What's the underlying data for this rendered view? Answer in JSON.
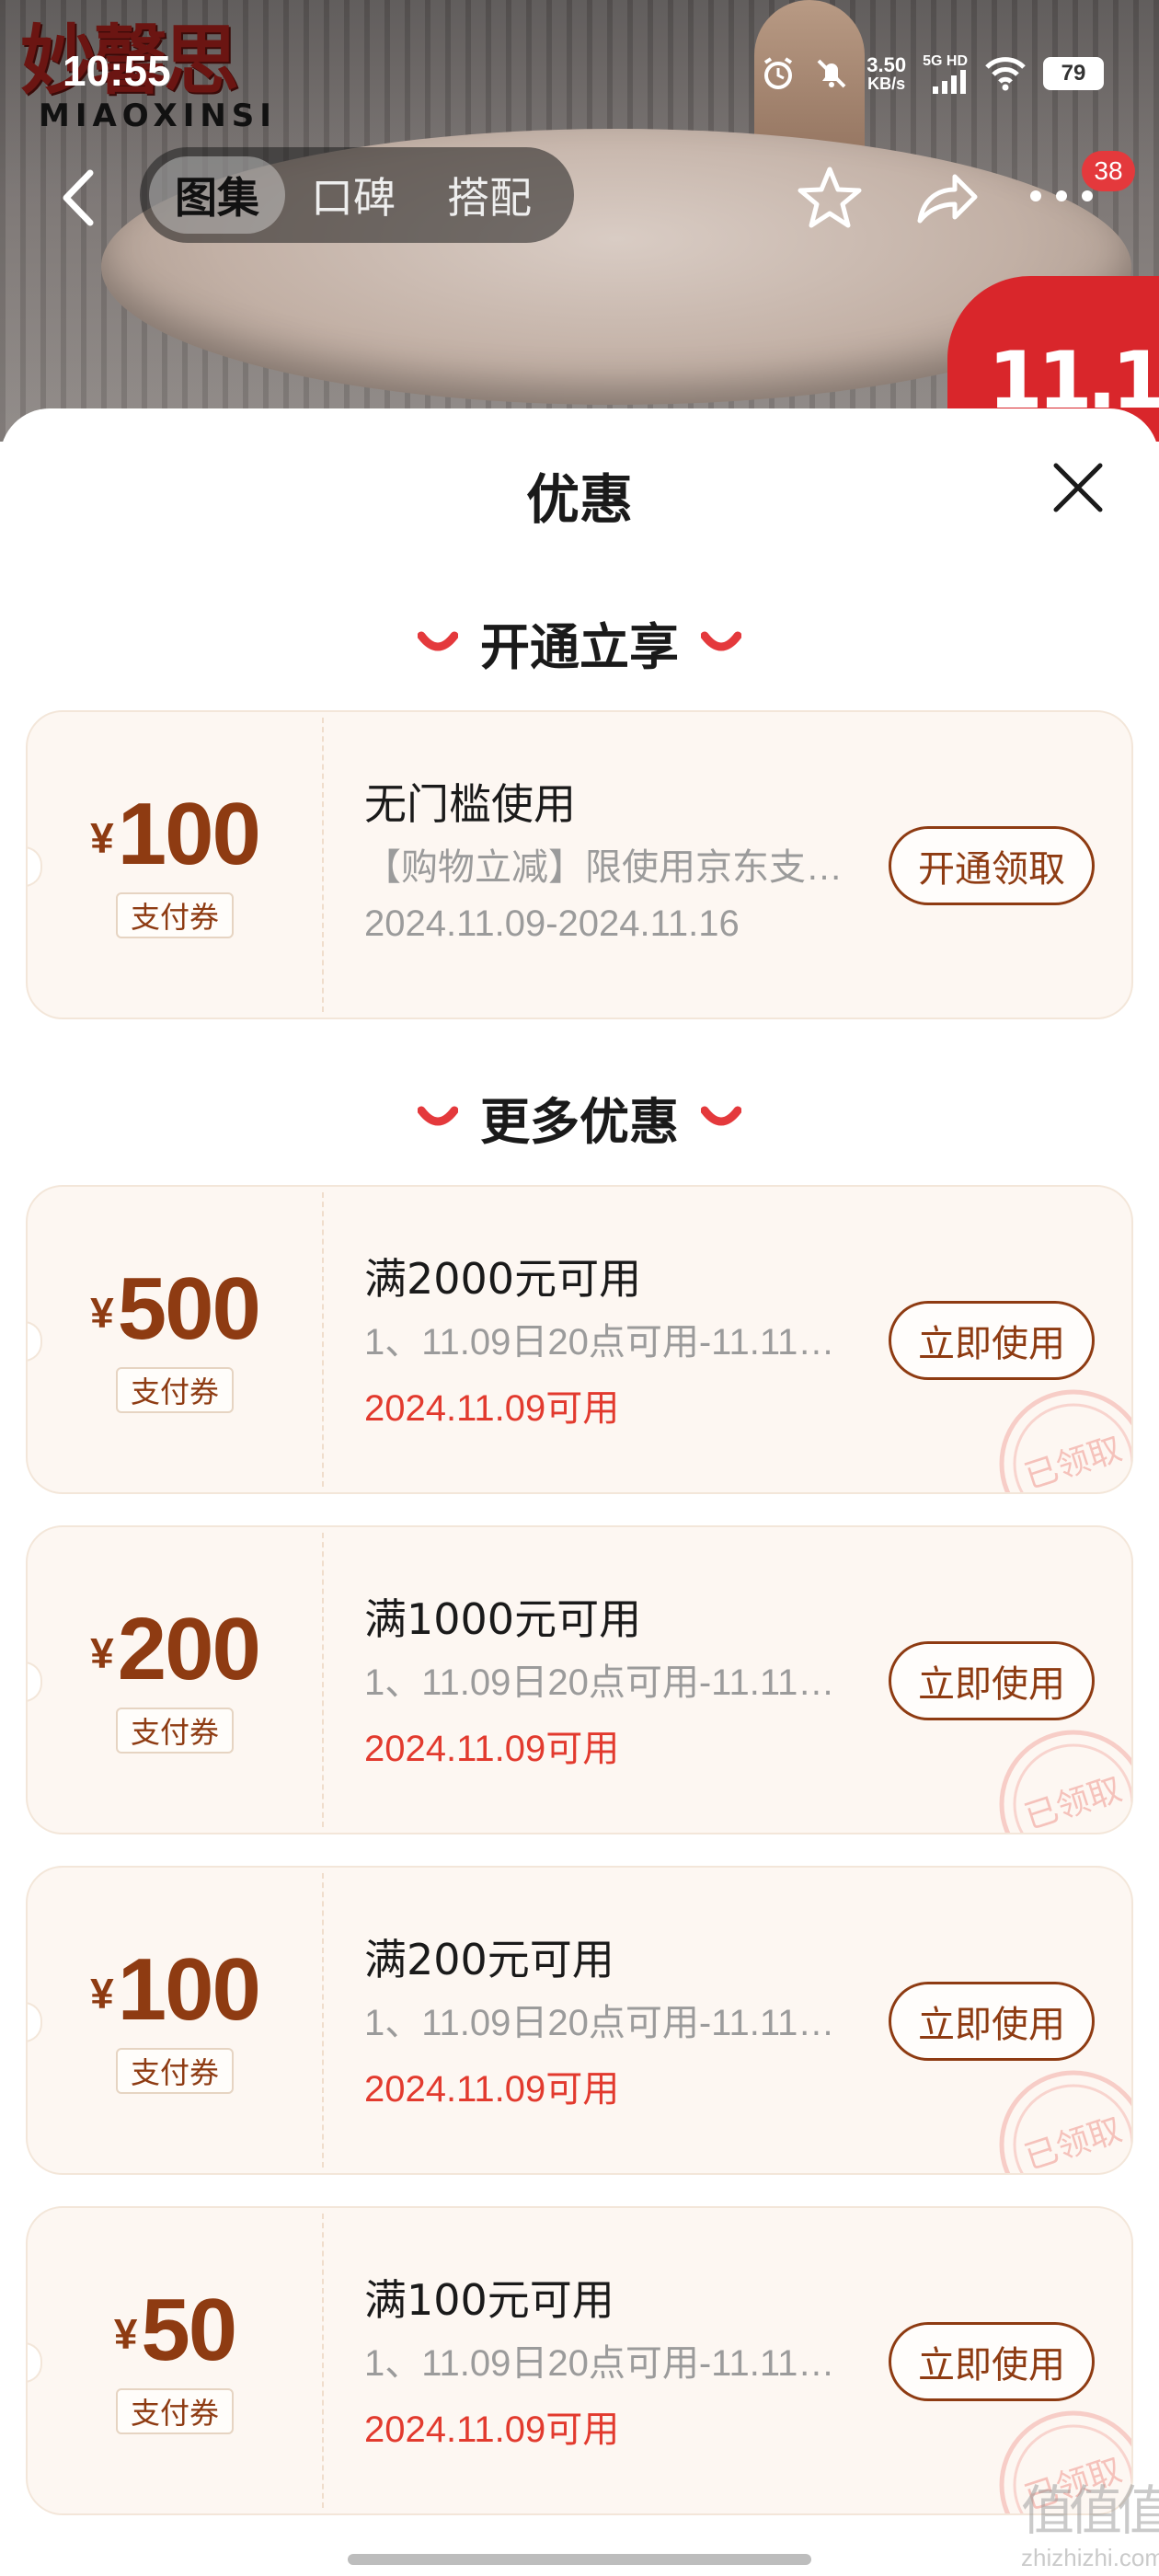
{
  "brand": {
    "logo_text": "妙馨思",
    "logo_latin": "MIAOXINSI"
  },
  "status_bar": {
    "time": "10:55",
    "net_speed_value": "3.50",
    "net_speed_unit": "KB/s",
    "signal_label": "5G HD",
    "battery": "79"
  },
  "nav": {
    "tabs": [
      {
        "label": "图集",
        "active": true
      },
      {
        "label": "口碑",
        "active": false
      },
      {
        "label": "搭配",
        "active": false
      }
    ],
    "message_count": "38"
  },
  "sheet": {
    "title": "优惠",
    "sections": [
      {
        "heading": "开通立享"
      },
      {
        "heading": "更多优惠"
      }
    ]
  },
  "coupons": [
    {
      "currency": "¥",
      "amount": "100",
      "type": "支付券",
      "title": "无门槛使用",
      "desc": "【购物立减】限使用京东支…",
      "date": "2024.11.09-2024.11.16",
      "date_highlight": false,
      "button": "开通领取",
      "claimed_stamp": false
    },
    {
      "currency": "¥",
      "amount": "500",
      "type": "支付券",
      "title": "满2000元可用",
      "desc": "1、11.09日20点可用-11.11…",
      "date": "2024.11.09可用",
      "date_highlight": true,
      "button": "立即使用",
      "claimed_stamp": true,
      "stamp_text": "已领取"
    },
    {
      "currency": "¥",
      "amount": "200",
      "type": "支付券",
      "title": "满1000元可用",
      "desc": "1、11.09日20点可用-11.11…",
      "date": "2024.11.09可用",
      "date_highlight": true,
      "button": "立即使用",
      "claimed_stamp": true,
      "stamp_text": "已领取"
    },
    {
      "currency": "¥",
      "amount": "100",
      "type": "支付券",
      "title": "满200元可用",
      "desc": "1、11.09日20点可用-11.11…",
      "date": "2024.11.09可用",
      "date_highlight": true,
      "button": "立即使用",
      "claimed_stamp": true,
      "stamp_text": "已领取"
    },
    {
      "currency": "¥",
      "amount": "50",
      "type": "支付券",
      "title": "满100元可用",
      "desc": "1、11.09日20点可用-11.11…",
      "date": "2024.11.09可用",
      "date_highlight": true,
      "button": "立即使用",
      "claimed_stamp": true,
      "stamp_text": "已领取"
    }
  ],
  "watermark": {
    "glyphs": "值值值",
    "site": "zhizhizhi.com"
  },
  "colors": {
    "accent_brown": "#8e3b12",
    "date_red": "#e23a2e",
    "badge_red": "#e4393c",
    "card_bg": "#fdf7f2"
  }
}
